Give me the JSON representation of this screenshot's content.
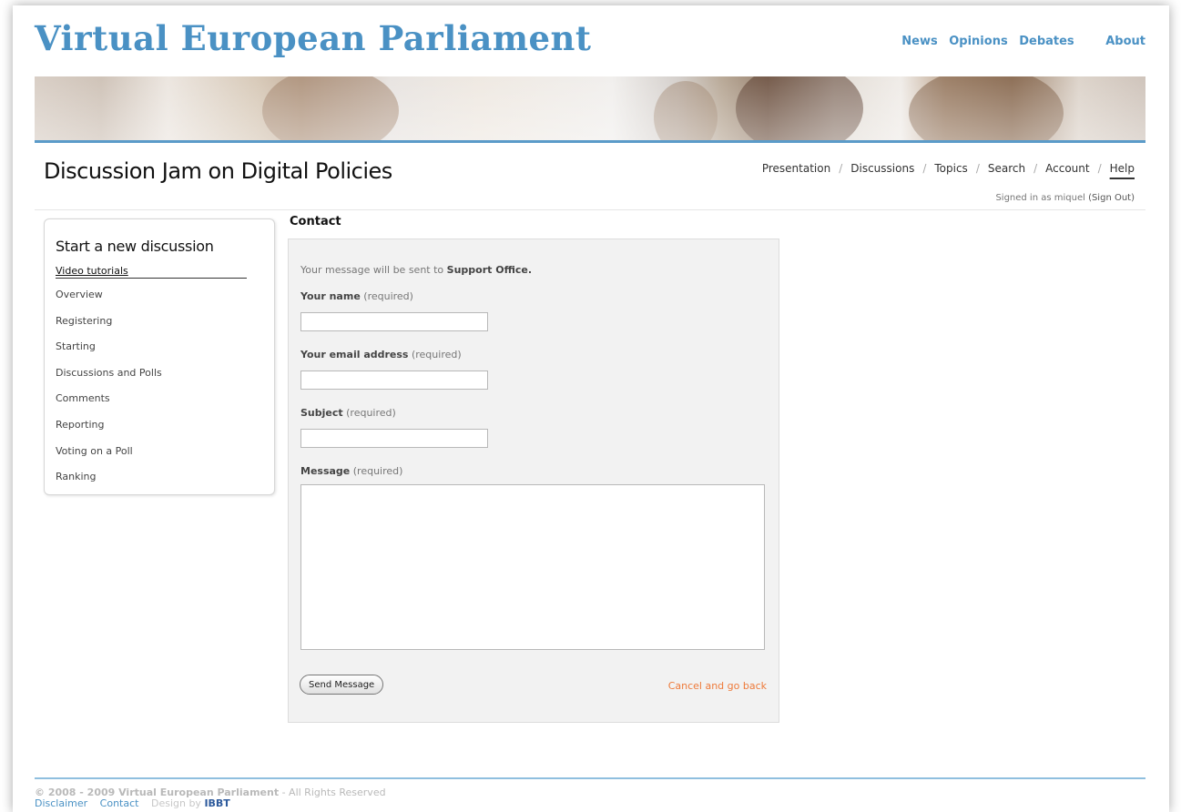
{
  "header": {
    "site_title": "Virtual European Parliament",
    "nav": [
      "News",
      "Opinions",
      "Debates",
      "About"
    ]
  },
  "section": {
    "title": "Discussion Jam on Digital Policies",
    "subnav": [
      "Presentation",
      "Discussions",
      "Topics",
      "Search",
      "Account",
      "Help"
    ],
    "separator": "/",
    "signed_in_prefix": "Signed in as miquel",
    "sign_out": "(Sign Out)"
  },
  "sidebar": {
    "start_link": "Start a new discussion",
    "tutorials_heading": "Video tutorials",
    "items": [
      "Overview",
      "Registering",
      "Starting",
      "Discussions and Polls",
      "Comments",
      "Reporting",
      "Voting on a Poll",
      "Ranking"
    ]
  },
  "contact": {
    "heading": "Contact",
    "intro_prefix": "Your message will be sent to",
    "intro_target": "Support Office.",
    "name_label": "Your name",
    "email_label": "Your email address",
    "subject_label": "Subject",
    "message_label": "Message",
    "required": "(required)",
    "send_button": "Send Message",
    "cancel_link": "Cancel and go back",
    "name_value": "",
    "email_value": "",
    "subject_value": "",
    "message_value": ""
  },
  "footer": {
    "copyright_strong": "© 2008 - 2009 Virtual European Parliament",
    "copyright_rest": "- All Rights Reserved",
    "links": [
      "Disclaimer",
      "Contact"
    ],
    "design_by": "Design by",
    "designer": "IBBT"
  },
  "colors": {
    "brand_blue": "#4a91c4",
    "accent_orange": "#ee7a3a",
    "rule_blue": "#5b9bc9"
  }
}
